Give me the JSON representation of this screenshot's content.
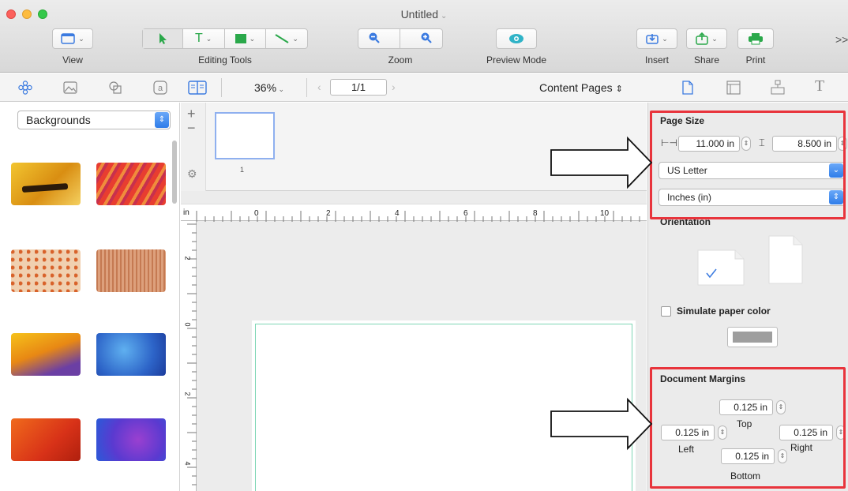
{
  "window": {
    "title": "Untitled"
  },
  "toolbar": {
    "view_label": "View",
    "editing_tools_label": "Editing Tools",
    "zoom_label": "Zoom",
    "preview_mode_label": "Preview Mode",
    "insert_label": "Insert",
    "share_label": "Share",
    "print_label": "Print",
    "overflow": ">>"
  },
  "subbar": {
    "zoom_value": "36%",
    "page_value": "1/1",
    "content_pages": "Content Pages"
  },
  "left": {
    "category": "Backgrounds",
    "thumbnails": [
      {
        "name": "yellow-brush",
        "color": "#e6b21b"
      },
      {
        "name": "red-orange-streaks",
        "color": "#e2443a"
      },
      {
        "name": "spotted-orange",
        "color": "#e8a57b"
      },
      {
        "name": "brown-lines",
        "color": "#c08360"
      },
      {
        "name": "yellow-purple",
        "color": "#e9a51a"
      },
      {
        "name": "blue-paint",
        "color": "#3a7fd8"
      },
      {
        "name": "red-orange",
        "color": "#e64a1e"
      },
      {
        "name": "purple-blue",
        "color": "#6b3fc8"
      }
    ]
  },
  "pages": {
    "first_page_number": "1"
  },
  "ruler": {
    "unit": "in",
    "h_labels": [
      "0",
      "2",
      "4",
      "6",
      "8",
      "10"
    ],
    "v_labels": [
      "2",
      "0",
      "2",
      "4"
    ]
  },
  "inspector": {
    "page_size": {
      "title": "Page Size",
      "width": "11.000 in",
      "height": "8.500 in",
      "paper": "US Letter",
      "units": "Inches (in)"
    },
    "orientation": {
      "title": "Orientation"
    },
    "simulate_paper_color": {
      "label": "Simulate paper color",
      "checked": false,
      "swatch": "#9e9e9e"
    },
    "margins": {
      "title": "Document Margins",
      "top": "0.125 in",
      "top_label": "Top",
      "left": "0.125 in",
      "left_label": "Left",
      "right": "0.125 in",
      "right_label": "Right",
      "bottom": "0.125 in",
      "bottom_label": "Bottom"
    }
  },
  "colors": {
    "accent": "#2f7de9",
    "highlight": "#e8343c",
    "margin_guide": "#7fd6b5"
  }
}
